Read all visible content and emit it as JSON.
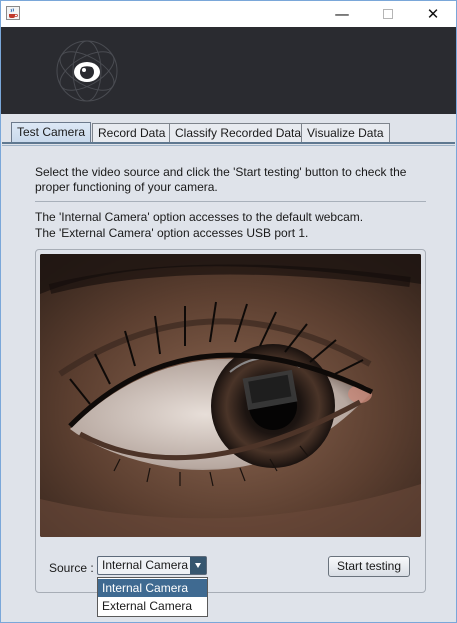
{
  "window": {
    "icon": "java-cup-icon",
    "controls": {
      "minimize": "—",
      "close": "✕"
    }
  },
  "tabs": [
    {
      "label": "Test Camera",
      "active": true
    },
    {
      "label": "Record Data",
      "active": false
    },
    {
      "label": "Classify Recorded Data",
      "active": false
    },
    {
      "label": "Visualize Data",
      "active": false
    }
  ],
  "test_camera": {
    "intro": "Select the video source and click the 'Start testing' button to check the proper functioning of your camera.",
    "internal_note": "The 'Internal Camera' option accesses to the default webcam.",
    "external_note": "The 'External Camera' option accesses USB port 1.",
    "source_label": "Source :",
    "source_selected": "Internal Camera",
    "source_options": [
      "Internal Camera",
      "External Camera"
    ],
    "start_button": "Start testing"
  },
  "colors": {
    "banner": "#2a2b30",
    "background": "#dfe3ea",
    "selection": "#3f6a91"
  }
}
